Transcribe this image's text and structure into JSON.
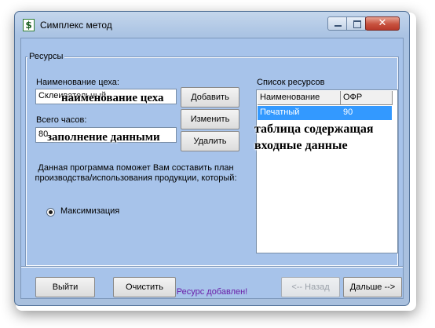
{
  "window": {
    "title": "Симплекс метод",
    "icon": "dollar-icon"
  },
  "resources": {
    "group_label": "Ресурсы",
    "name_label": "Наименование цеха:",
    "name_value": "Склеивательный",
    "hours_label": "Всего часов:",
    "hours_value": "80",
    "add_label": "Добавить",
    "edit_label": "Изменить",
    "delete_label": "Удалить",
    "description": "Данная программа поможет Вам составить план производства/использования продукции, который:",
    "option_label": "Максимизация",
    "list_label": "Список ресурсов",
    "columns": [
      "Наименование",
      "ОФР"
    ],
    "rows": [
      {
        "name": "Печатный",
        "value": "90",
        "selected": true
      }
    ]
  },
  "annotations": {
    "name": "наименование цеха",
    "data": "заполнение данными",
    "table_line1": "таблица содержащая",
    "table_line2": "входные данные"
  },
  "footer": {
    "exit_label": "Выйти",
    "clear_label": "Очистить",
    "back_label": "<-- Назад",
    "next_label": "Дальше -->",
    "status": "Ресурс добавлен!"
  },
  "colors": {
    "selection": "#3399ff",
    "status": "#6a1fa8",
    "client": "#a7c3ea"
  }
}
